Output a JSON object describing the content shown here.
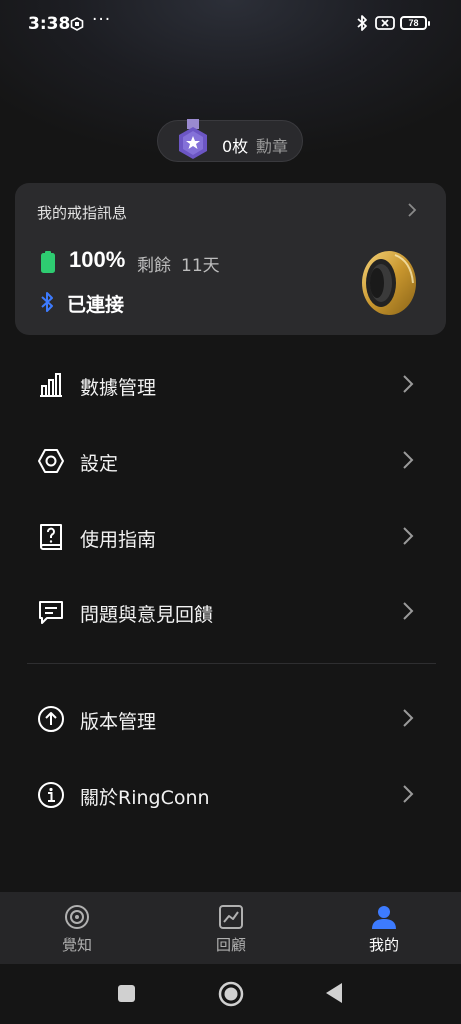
{
  "status_bar": {
    "time": "3:38",
    "more": "···",
    "battery": "78",
    "icons": [
      "mi-icon",
      "hexagon-icon",
      "bluetooth-icon",
      "battery-saver-icon",
      "battery-icon"
    ]
  },
  "medals": {
    "count": "0枚",
    "label": "勳章"
  },
  "ring_card": {
    "title": "我的戒指訊息",
    "battery_percent": "100%",
    "remaining_label": "剩餘",
    "remaining_days": "11天",
    "connection_status": "已連接",
    "battery_color": "#2ecc71",
    "bluetooth_color": "#3d7bff"
  },
  "menu": {
    "items": [
      {
        "label": "數據管理",
        "icon": "bar-chart-icon"
      },
      {
        "label": "設定",
        "icon": "hexagon-settings-icon"
      },
      {
        "label": "使用指南",
        "icon": "help-book-icon"
      },
      {
        "label": "問題與意見回饋",
        "icon": "feedback-icon"
      },
      {
        "label": "版本管理",
        "icon": "upload-circle-icon"
      },
      {
        "label": "關於RingConn",
        "icon": "info-icon"
      }
    ]
  },
  "bottom_nav": {
    "items": [
      {
        "label": "覺知",
        "icon": "target-icon",
        "active": false
      },
      {
        "label": "回顧",
        "icon": "trend-chart-icon",
        "active": false
      },
      {
        "label": "我的",
        "icon": "person-icon",
        "active": true
      }
    ],
    "active_color": "#3d7bff"
  }
}
